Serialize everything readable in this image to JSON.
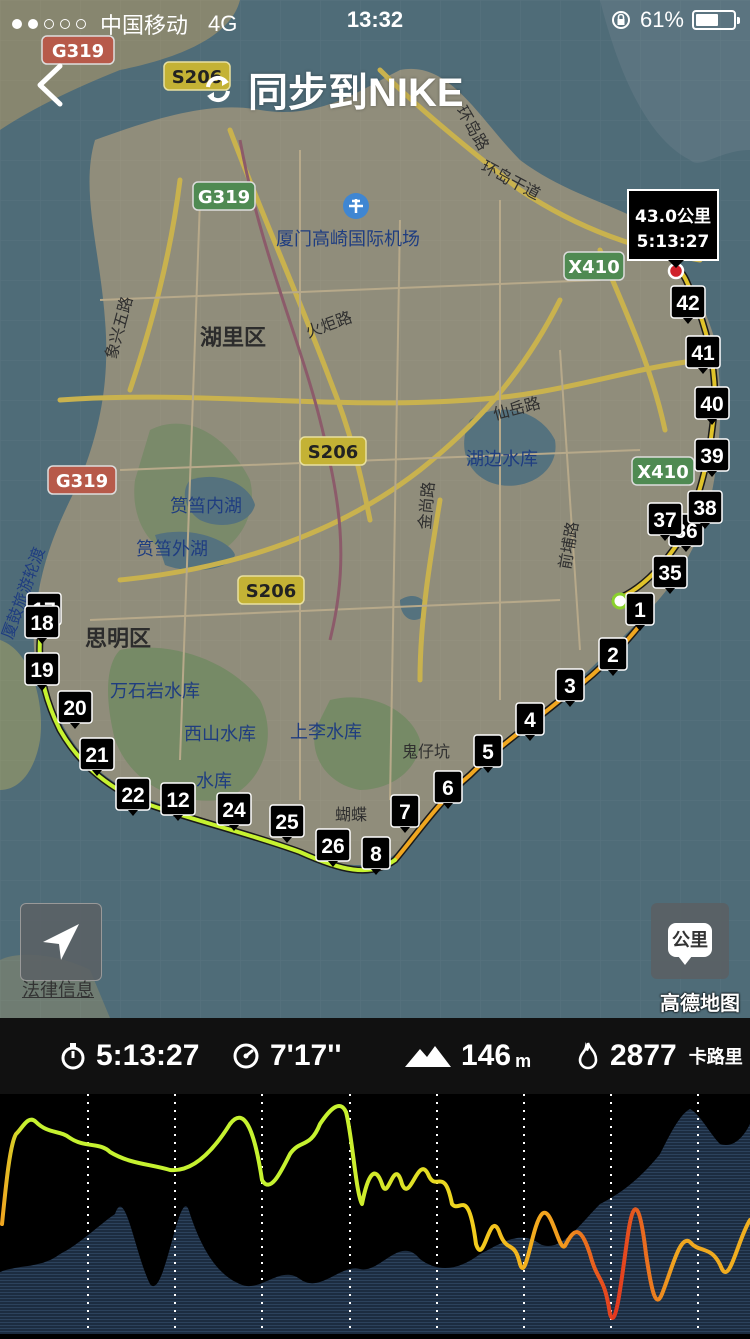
{
  "status_bar": {
    "carrier": "中国移动",
    "network": "4G",
    "time": "13:32",
    "battery": "61%",
    "battery_fraction": 0.61
  },
  "nav": {
    "title": "同步到NIKE"
  },
  "map": {
    "road_badges": [
      "G319",
      "S206",
      "G319",
      "X410",
      "S206",
      "G319",
      "X410",
      "S206"
    ],
    "labels": {
      "airport": "厦门高崎国际机场",
      "huli": "湖里区",
      "siming": "思明区",
      "huoju": "火炬路",
      "xianyue": "仙岳路",
      "hubian": "湖边水库",
      "yundang_in": "筼筜内湖",
      "yundang_out": "筼筜外湖",
      "wanshiyan": "万石岩水库",
      "xishan": "西山水库",
      "shangli": "上李水库",
      "xiangxing": "象兴五路",
      "jinshang": "金尚路",
      "qianpu": "前埔路",
      "huandao_gan": "环岛干道",
      "huandao": "环岛路",
      "guizai": "鬼仔坑",
      "hudie": "蝴蝶",
      "ferry": "厦鼓旅游轮渡",
      "reservoir_small": "水库"
    },
    "end_flag": {
      "distance": "43.0公里",
      "time": "5:13:27"
    },
    "km_markers": [
      "1",
      "2",
      "3",
      "4",
      "5",
      "6",
      "7",
      "8",
      "12",
      "17",
      "18",
      "19",
      "20",
      "21",
      "22",
      "24",
      "25",
      "26",
      "35",
      "36",
      "37",
      "38",
      "39",
      "40",
      "41",
      "42"
    ],
    "locate_button": "locate",
    "unit_button": "公里",
    "legal": "法律信息",
    "amap": "高德地图"
  },
  "stats": {
    "duration": "5:13:27",
    "pace": "7'17''",
    "elevation": "146",
    "elevation_unit": "m",
    "calories": "2877",
    "calories_unit": "卡路里"
  },
  "colors": {
    "route_fast": "#c6f230",
    "route_mid": "#f5b81e",
    "route_slow": "#e2371f",
    "water": "#4f6c78",
    "land": "#8f8c7a",
    "chart_bg": "#000000",
    "elevation_fill": "#22354c"
  }
}
